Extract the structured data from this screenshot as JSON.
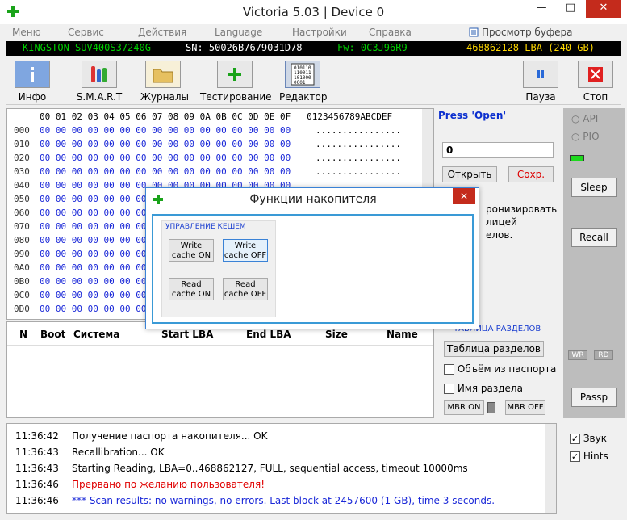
{
  "window": {
    "title": "Victoria 5.03 | Device 0",
    "minimize": "—",
    "maximize": "□",
    "close": "✕"
  },
  "menu": {
    "items": [
      "Меню",
      "Сервис",
      "Действия",
      "Language",
      "Настройки",
      "Справка",
      "Просмотр буфера"
    ]
  },
  "device": {
    "model": "KINGSTON SUV400S37240G",
    "sn": "SN: 50026B7679031D78",
    "fw": "Fw: 0C3J96R9",
    "capacity": "468862128 LBA (240 GB)"
  },
  "toolbar": {
    "info": "Инфо",
    "smart": "S.M.A.R.T",
    "logs": "Журналы",
    "testing": "Тестирование",
    "editor": "Редактор",
    "editor_icon_text": "010110\n110011\n101000\n0001",
    "pause": "Пауза",
    "stop": "Стоп"
  },
  "hex": {
    "header": "00 01 02 03 04 05 06 07 08 09 0A 0B 0C 0D 0E 0F   0123456789ABCDEF",
    "rows": [
      {
        "off": "000",
        "bytes": "00 00 00 00 00 00 00 00 00 00 00 00 00 00 00 00",
        "ascii": "................"
      },
      {
        "off": "010",
        "bytes": "00 00 00 00 00 00 00 00 00 00 00 00 00 00 00 00",
        "ascii": "................"
      },
      {
        "off": "020",
        "bytes": "00 00 00 00 00 00 00 00 00 00 00 00 00 00 00 00",
        "ascii": "................"
      },
      {
        "off": "030",
        "bytes": "00 00 00 00 00 00 00 00 00 00 00 00 00 00 00 00",
        "ascii": "................"
      },
      {
        "off": "040",
        "bytes": "00 00 00 00 00 00 00 00 00 00 00 00 00 00 00 00",
        "ascii": "................"
      },
      {
        "off": "050",
        "bytes": "00 00 00 00 00 00 00 00 00 00 00 00 00 00 00 00",
        "ascii": "................"
      },
      {
        "off": "060",
        "bytes": "00 00 00 00 00 00 00 00 00 00 00 00 00 00 00 00",
        "ascii": "................"
      },
      {
        "off": "070",
        "bytes": "00 00 00 00 00 00 00 00 00 00 00 00 00 00 00 00",
        "ascii": "................"
      },
      {
        "off": "080",
        "bytes": "00 00 00 00 00 00 00 00 00 00 00 00 00 00 00 00",
        "ascii": "................"
      },
      {
        "off": "090",
        "bytes": "00 00 00 00 00 00 00 00 00 00 00 00 00 00 00 00",
        "ascii": "................"
      },
      {
        "off": "0A0",
        "bytes": "00 00 00 00 00 00 00 00 00 00 00 00 00 00 00 00",
        "ascii": "................"
      },
      {
        "off": "0B0",
        "bytes": "00 00 00 00 00 00 00 00 00 00 00 00 00 00 00 00",
        "ascii": "................"
      },
      {
        "off": "0C0",
        "bytes": "00 00 00 00 00 00 00 00 00 00 00 00 00 00 00 00",
        "ascii": "................"
      },
      {
        "off": "0D0",
        "bytes": "00 00 00 00 00 00 00 00 00 00 00 00 00 00 00 00",
        "ascii": "................"
      }
    ]
  },
  "editor_panel": {
    "press": "Press 'Open'",
    "value": "0",
    "open": "Открыть",
    "save": "Сохр.",
    "sync_1": "ронизировать",
    "sync_2": "лицей",
    "sync_3": "елов."
  },
  "sidebar": {
    "api": "API",
    "pio": "PIO",
    "sleep": "Sleep",
    "recall": "Recall",
    "wr": "WR",
    "rd": "RD",
    "passp": "Passp"
  },
  "partitions": {
    "headers": [
      "N",
      "Boot",
      "Система",
      "Start LBA",
      "End LBA",
      "Size",
      "Name"
    ],
    "table_label": "ТАБЛИЦА РАЗДЕЛОВ",
    "table_button": "Таблица разделов",
    "from_passport": "Объём из паспорта",
    "part_name": "Имя раздела",
    "mbr_on": "MBR ON",
    "mbr_off": "MBR OFF"
  },
  "log": [
    {
      "time": "11:36:42",
      "msg": "Получение паспорта накопителя... OK",
      "color": "#000000"
    },
    {
      "time": "11:36:43",
      "msg": "Recallibration... OK",
      "color": "#000000"
    },
    {
      "time": "11:36:43",
      "msg": "Starting Reading, LBA=0..468862127, FULL, sequential access, timeout 10000ms",
      "color": "#000000"
    },
    {
      "time": "11:36:46",
      "msg": "Прервано по желанию пользователя!",
      "color": "#e00000"
    },
    {
      "time": "11:36:46",
      "msg": "*** Scan results: no warnings, no errors. Last block at 2457600 (1 GB), time 3 seconds.",
      "color": "#1a28d8"
    }
  ],
  "options": {
    "sound": "Звук",
    "hints": "Hints"
  },
  "dialog": {
    "title": "Функции накопителя",
    "close": "✕",
    "group_title": "УПРАВЛЕНИЕ КЕШЕМ",
    "write_on": "Write\ncache ON",
    "write_off": "Write\ncache OFF",
    "read_on": "Read\ncache ON",
    "read_off": "Read\ncache OFF"
  },
  "colors": {
    "model": "#00d000",
    "sn": "#ffffff",
    "fw": "#00d000",
    "capacity": "#ffd800",
    "accent": "#3a82d6",
    "close": "#c42b1c"
  }
}
